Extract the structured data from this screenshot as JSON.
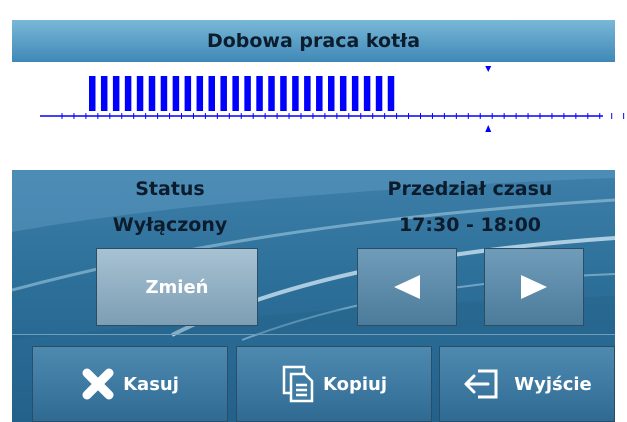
{
  "title": "Dobowa praca kotła",
  "timeline": {
    "active_slots": 26,
    "total_slots": 48,
    "current_slot": 35
  },
  "status": {
    "label": "Status",
    "value": "Wyłączony",
    "change_button": "Zmień"
  },
  "interval": {
    "label": "Przedział czasu",
    "value": "17:30 - 18:00",
    "prev_icon": "left-arrow-icon",
    "next_icon": "right-arrow-icon"
  },
  "footer": {
    "delete_label": "Kasuj",
    "copy_label": "Kopiuj",
    "exit_label": "Wyjście"
  },
  "colors": {
    "accent": "#0000ff",
    "header": "#4f94c2",
    "panel": "#2f71a0"
  }
}
